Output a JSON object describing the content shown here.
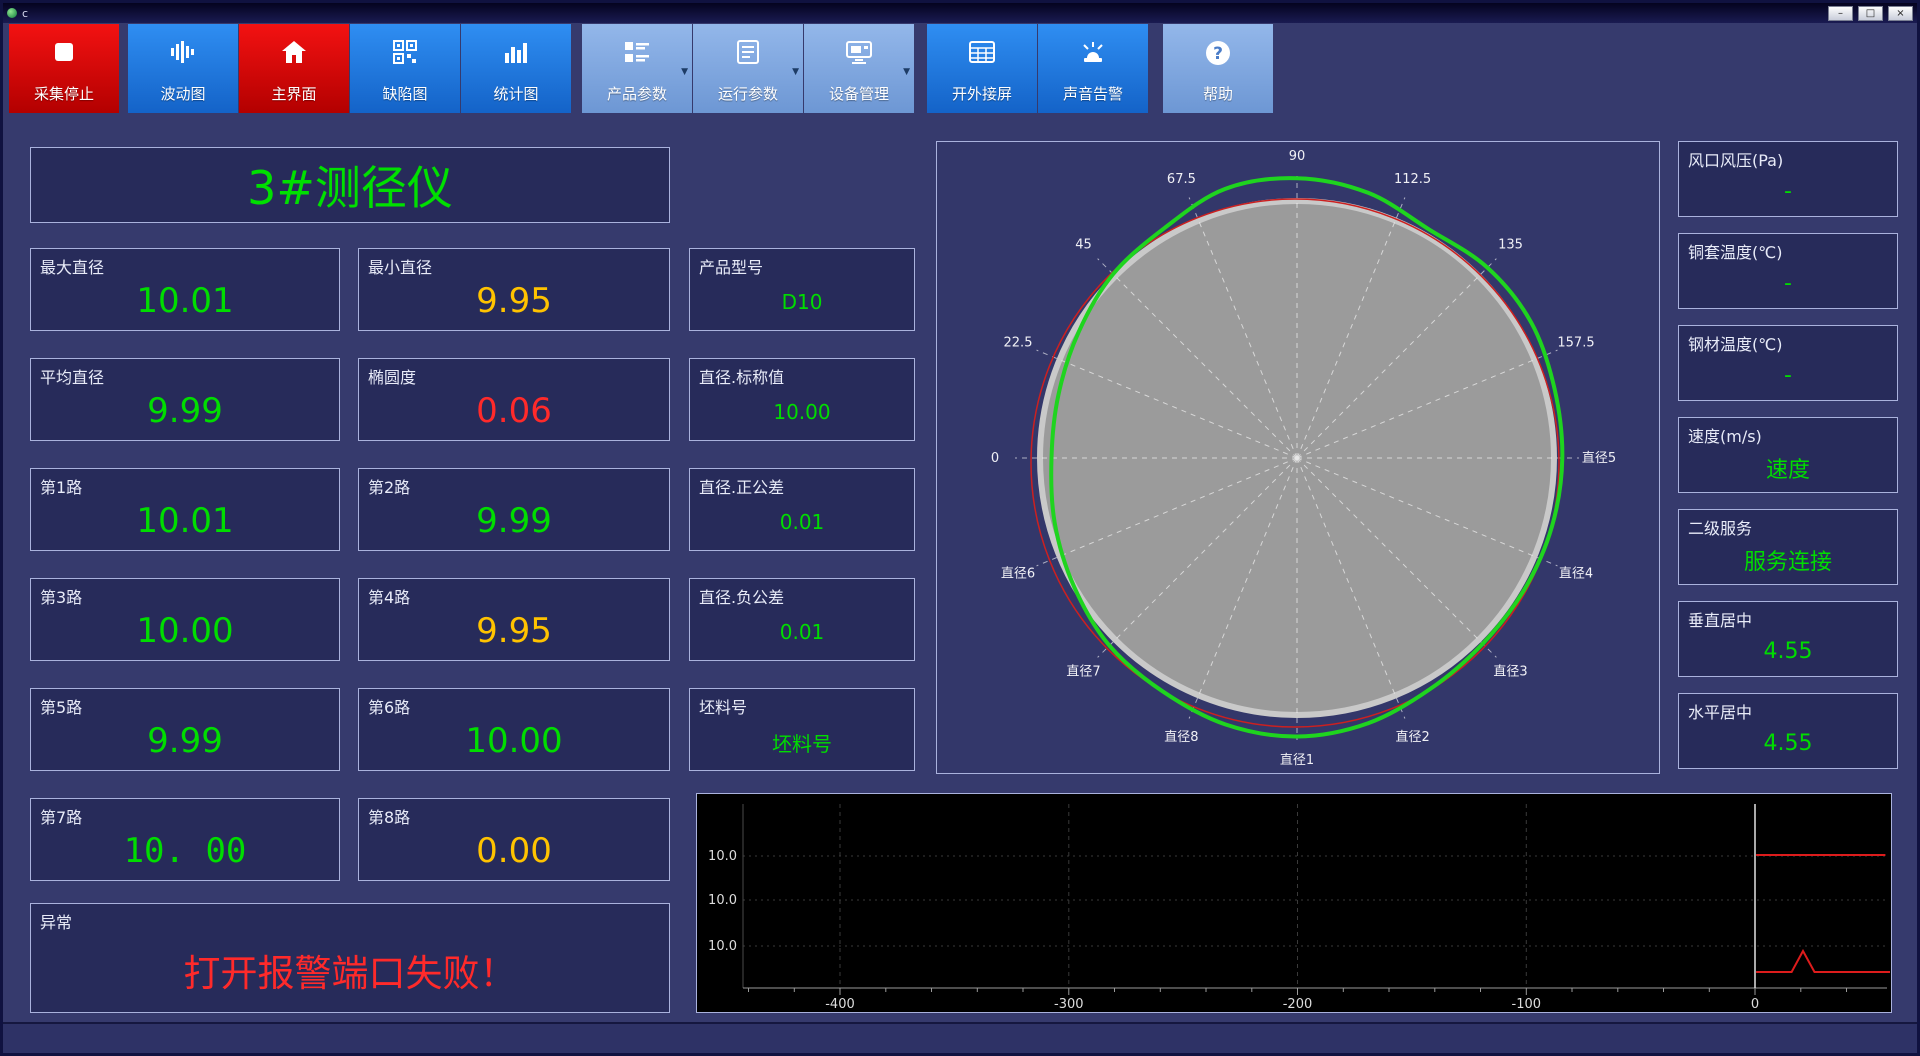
{
  "window": {
    "title": "c",
    "controls": {
      "minimize": "–",
      "maximize": "□",
      "close": "×"
    }
  },
  "toolbar": [
    {
      "id": "stop-collect",
      "label": "采集停止",
      "color": "red",
      "icon": "stop-icon"
    },
    {
      "id": "wave-chart",
      "label": "波动图",
      "color": "blue",
      "icon": "waveform-icon"
    },
    {
      "id": "main-screen",
      "label": "主界面",
      "color": "red",
      "icon": "home-icon"
    },
    {
      "id": "defect-chart",
      "label": "缺陷图",
      "color": "blue",
      "icon": "defect-grid-icon"
    },
    {
      "id": "stats-chart",
      "label": "统计图",
      "color": "blue",
      "icon": "bar-chart-icon"
    },
    {
      "id": "product-params",
      "label": "产品参数",
      "color": "light",
      "icon": "product-list-icon",
      "dropdown": true
    },
    {
      "id": "run-params",
      "label": "运行参数",
      "color": "light",
      "icon": "document-icon",
      "dropdown": true
    },
    {
      "id": "device-manage",
      "label": "设备管理",
      "color": "light",
      "icon": "monitor-icon",
      "dropdown": true
    },
    {
      "id": "external-screen",
      "label": "开外接屏",
      "color": "blue",
      "icon": "table-grid-icon"
    },
    {
      "id": "sound-alarm",
      "label": "声音告警",
      "color": "blue",
      "icon": "siren-icon"
    },
    {
      "id": "help",
      "label": "帮助",
      "color": "light",
      "icon": "question-icon"
    }
  ],
  "header": {
    "title": "3#测径仪"
  },
  "left_panels": [
    {
      "id": "max-diameter",
      "label": "最大直径",
      "value": "10.01",
      "color": "green",
      "col": 0,
      "row": 0
    },
    {
      "id": "min-diameter",
      "label": "最小直径",
      "value": "9.95",
      "color": "yellow",
      "col": 1,
      "row": 0
    },
    {
      "id": "product-model",
      "label": "产品型号",
      "value": "D10",
      "color": "green",
      "col": 2,
      "row": 0,
      "small": true
    },
    {
      "id": "avg-diameter",
      "label": "平均直径",
      "value": "9.99",
      "color": "green",
      "col": 0,
      "row": 1
    },
    {
      "id": "ovality",
      "label": "椭圆度",
      "value": "0.06",
      "color": "red",
      "col": 1,
      "row": 1
    },
    {
      "id": "nominal-diameter",
      "label": "直径.标称值",
      "value": "10.00",
      "color": "green",
      "col": 2,
      "row": 1,
      "small": true
    },
    {
      "id": "channel-1",
      "label": "第1路",
      "value": "10.01",
      "color": "green",
      "col": 0,
      "row": 2
    },
    {
      "id": "channel-2",
      "label": "第2路",
      "value": "9.99",
      "color": "green",
      "col": 1,
      "row": 2
    },
    {
      "id": "plus-tolerance",
      "label": "直径.正公差",
      "value": "0.01",
      "color": "green",
      "col": 2,
      "row": 2,
      "small": true
    },
    {
      "id": "channel-3",
      "label": "第3路",
      "value": "10.00",
      "color": "green",
      "col": 0,
      "row": 3
    },
    {
      "id": "channel-4",
      "label": "第4路",
      "value": "9.95",
      "color": "yellow",
      "col": 1,
      "row": 3
    },
    {
      "id": "minus-tolerance",
      "label": "直径.负公差",
      "value": "0.01",
      "color": "green",
      "col": 2,
      "row": 3,
      "small": true
    },
    {
      "id": "channel-5",
      "label": "第5路",
      "value": "9.99",
      "color": "green",
      "col": 0,
      "row": 4
    },
    {
      "id": "channel-6",
      "label": "第6路",
      "value": "10.00",
      "color": "green",
      "col": 1,
      "row": 4
    },
    {
      "id": "billet-number",
      "label": "坯料号",
      "value": "坯料号",
      "color": "green",
      "col": 2,
      "row": 4,
      "small": true
    },
    {
      "id": "channel-7",
      "label": "第7路",
      "value": "10. 00",
      "color": "green",
      "col": 0,
      "row": 5,
      "mono": true
    },
    {
      "id": "channel-8",
      "label": "第8路",
      "value": "0.00",
      "color": "yellow",
      "col": 1,
      "row": 5
    }
  ],
  "alarm_panel": {
    "label": "异常",
    "value": "打开报警端口失败！"
  },
  "side_panels": [
    {
      "id": "air-pressure",
      "label": "风口风压(Pa)",
      "value": "-"
    },
    {
      "id": "sleeve-temperature",
      "label": "铜套温度(℃)",
      "value": "-"
    },
    {
      "id": "steel-temperature",
      "label": "钢材温度(℃)",
      "value": "-"
    },
    {
      "id": "speed",
      "label": "速度(m/s)",
      "value": "速度"
    },
    {
      "id": "secondary-service",
      "label": "二级服务",
      "value": "服务连接"
    },
    {
      "id": "vertical-centering",
      "label": "垂直居中",
      "value": "4.55"
    },
    {
      "id": "horizontal-centering",
      "label": "水平居中",
      "value": "4.55"
    }
  ],
  "polar_chart": {
    "type": "polar-profile",
    "nominal_color": "#cc2020",
    "profile_color": "#1fd41f",
    "disc_color": "#9b9b9b",
    "labels": [
      {
        "angle": 180,
        "text": "0"
      },
      {
        "angle": 157.5,
        "text": "22.5"
      },
      {
        "angle": 135,
        "text": "45"
      },
      {
        "angle": 112.5,
        "text": "67.5"
      },
      {
        "angle": 90,
        "text": "90"
      },
      {
        "angle": 67.5,
        "text": "112.5"
      },
      {
        "angle": 45,
        "text": "135"
      },
      {
        "angle": 22.5,
        "text": "157.5"
      },
      {
        "angle": 0,
        "text": "直径5"
      },
      {
        "angle": -22.5,
        "text": "直径4"
      },
      {
        "angle": -45,
        "text": "直径3"
      },
      {
        "angle": -67.5,
        "text": "直径2"
      },
      {
        "angle": -90,
        "text": "直径1"
      },
      {
        "angle": -112.5,
        "text": "直径8"
      },
      {
        "angle": -135,
        "text": "直径7"
      },
      {
        "angle": -157.5,
        "text": "直径6"
      }
    ],
    "profile_angle_step": 15,
    "profile_ratio": [
      1.005,
      1.01,
      1.025,
      1.02,
      1.0,
      1.04,
      1.06,
      1.055,
      1.005,
      0.985,
      0.955,
      0.935,
      0.93,
      0.95,
      0.975,
      1.005,
      1.02,
      1.045,
      1.055,
      1.04,
      1.01,
      0.995,
      0.995,
      1.0
    ]
  },
  "trend_chart": {
    "type": "line",
    "y_axis_labels": [
      "10.0",
      "10.0",
      "10.0"
    ],
    "x_ticks": [
      -400,
      -300,
      -200,
      -100,
      0
    ],
    "x_range": [
      -462,
      60
    ],
    "minor_tick_step": 20,
    "cursor_x": 0,
    "trace_color": "#dd1c1c",
    "traces": [
      {
        "name": "upper",
        "points": [
          [
            0.5,
            61
          ],
          [
            57,
            61
          ]
        ]
      },
      {
        "name": "lower",
        "points": [
          [
            0.5,
            178
          ],
          [
            16,
            178
          ],
          [
            21,
            157
          ],
          [
            26,
            178
          ],
          [
            59,
            178
          ]
        ]
      }
    ]
  },
  "colors": {
    "green": "#00dd00",
    "yellow": "#ffc300",
    "red": "#ff2a2a"
  }
}
